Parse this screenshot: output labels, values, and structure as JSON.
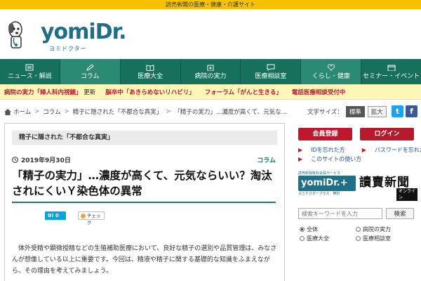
{
  "topbar": "読売新聞の医療・健康・介護サイト",
  "logo": {
    "word": "yomiDr.",
    "sub": "ヨミドクター"
  },
  "nav": [
    {
      "label": "ニュース・解説",
      "icon": "newspaper-icon"
    },
    {
      "label": "コラム",
      "icon": "pen-icon",
      "active": true
    },
    {
      "label": "医療大全",
      "icon": "book-icon"
    },
    {
      "label": "病院の実力",
      "icon": "hospital-icon"
    },
    {
      "label": "医療相談室",
      "icon": "chat-icon"
    },
    {
      "label": "くらし・健康",
      "icon": "heart-icon"
    },
    {
      "label": "セミナー・イベント",
      "icon": "calendar-icon"
    }
  ],
  "subnav": [
    {
      "pre": "病院の実力「婦人科内視鏡」",
      "post": "更新"
    },
    {
      "pre": "脳卒中「あきらめないリハビリ」",
      "post": ""
    },
    {
      "pre": "フォーラム「がんと生きる」",
      "post": ""
    },
    {
      "pre": "電話医療相談受付中",
      "post": ""
    }
  ],
  "breadcrumb": [
    "ホーム",
    "コラム",
    "精子に隠された「不都合な真実」",
    "「精子の実力」…濃度が高くて、元気な…"
  ],
  "fontsize": {
    "label": "文字サイズ：",
    "standard": "標準",
    "large": "拡大"
  },
  "social": {
    "twitter": "t",
    "facebook": "f"
  },
  "article": {
    "series": "精子に隠された「不都合な真実」",
    "date": "2019年9月30日",
    "category": "コラム",
    "title": "「精子の実力」…濃度が高くて、元気ならいい？淘汰されにくいＹ染色体の異常",
    "bl_label": "B! 0",
    "check_label": "チェック",
    "body": "体外受精や顕微授精などの生殖補助医療において、良好な精子の選別や品質管理は、みなさんが想像している以上に重要です。今回は、精液や精子に関する基礎的な知識をふまえながら、その理由を考えてみましょう。"
  },
  "sidebar": {
    "register": "会員登録",
    "login": "ログイン",
    "forgot_id": "IDを忘れた方",
    "forgot_pw": "パスワードを忘れた方",
    "usage": "このサイトの使い方",
    "plus_top": "読売新聞有料会員サービス",
    "plus_name": "yomiDr.+",
    "plus_sub": "ヨミドクタープラス　無料",
    "yomiuri": "讀賣新聞",
    "online": "オンライン",
    "search_placeholder": "検索キーワードを入力",
    "search_button": "検索",
    "radios": [
      {
        "label": "全体",
        "checked": true
      },
      {
        "label": "病院の実力",
        "checked": false
      },
      {
        "label": "医療大全",
        "checked": false
      },
      {
        "label": "医療相談室",
        "checked": false
      }
    ]
  },
  "colors": {
    "nav": "#17705c",
    "accent": "#1f6f86",
    "register": "#c0172d",
    "login": "#b71a2b",
    "topbar": "#f6c200"
  }
}
